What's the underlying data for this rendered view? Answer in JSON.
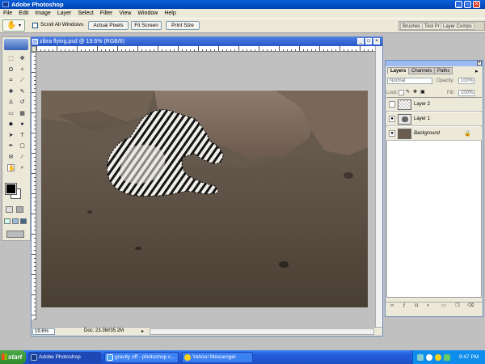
{
  "app": {
    "title": "Adobe Photoshop"
  },
  "menu": [
    "File",
    "Edit",
    "Image",
    "Layer",
    "Select",
    "Filter",
    "View",
    "Window",
    "Help"
  ],
  "options_bar": {
    "scroll_all_label": "Scroll All Windows",
    "scroll_all_checked": false,
    "buttons": [
      "Actual Pixels",
      "Fit Screen",
      "Print Size"
    ],
    "palette_well_tabs": [
      "Brushes",
      "Tool Pr",
      "Layer Comps"
    ]
  },
  "document": {
    "title": "zibra flying.psd @ 19.6% (RGB/8)",
    "zoom": "19.6%",
    "doc_info": "Doc: 23.3M/35.2M"
  },
  "layers_palette": {
    "tabs": [
      "Layers",
      "Channels",
      "Paths"
    ],
    "blend_mode": "Normal",
    "opacity_label": "Opacity:",
    "opacity_value": "100%",
    "lock_label": "Lock:",
    "fill_label": "Fill:",
    "fill_value": "100%",
    "layers": [
      {
        "name": "Layer 2",
        "visible": false
      },
      {
        "name": "Layer 1",
        "visible": true
      },
      {
        "name": "Background",
        "visible": true,
        "locked": true
      }
    ]
  },
  "taskbar": {
    "start_label": "start",
    "tasks": [
      "Adobe Photoshop",
      "gravity off - photoshop c...",
      "Yahoo! Messenger"
    ],
    "clock": "9:47 PM"
  },
  "colors": {
    "title_bar": "#0a5fd8",
    "taskbar": "#245edb",
    "start_button": "#2d8b2c",
    "foreground_swatch": "#000000",
    "background_swatch": "#ffffff"
  },
  "icons": [
    "move-tool-icon",
    "marquee-tool-icon",
    "lasso-tool-icon",
    "magic-wand-icon",
    "crop-tool-icon",
    "slice-tool-icon",
    "healing-brush-icon",
    "brush-tool-icon",
    "clone-stamp-icon",
    "history-brush-icon",
    "eraser-icon",
    "gradient-icon",
    "blur-icon",
    "dodge-icon",
    "path-select-icon",
    "type-tool-icon",
    "pen-tool-icon",
    "shape-tool-icon",
    "notes-icon",
    "eyedropper-icon",
    "hand-tool-icon",
    "zoom-tool-icon",
    "eye-icon",
    "lock-icon",
    "speaker-icon",
    "network-icon"
  ]
}
